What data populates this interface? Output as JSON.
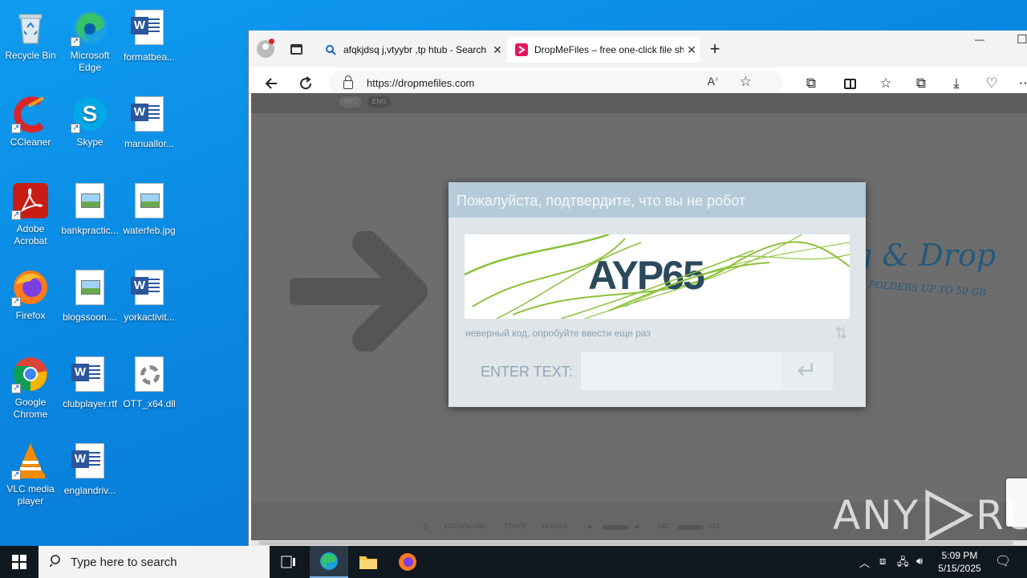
{
  "desktop": {
    "icons": [
      {
        "label": "Recycle Bin",
        "icon": "recycle-bin-icon"
      },
      {
        "label": "Microsoft Edge",
        "icon": "edge-icon"
      },
      {
        "label": "formatbea...",
        "icon": "word-doc-icon"
      },
      {
        "label": "CCleaner",
        "icon": "ccleaner-icon"
      },
      {
        "label": "Skype",
        "icon": "skype-icon"
      },
      {
        "label": "manuallor...",
        "icon": "word-doc-icon"
      },
      {
        "label": "Adobe Acrobat",
        "icon": "acrobat-icon"
      },
      {
        "label": "bankpractic...",
        "icon": "image-file-icon"
      },
      {
        "label": "waterfeb.jpg",
        "icon": "image-file-icon"
      },
      {
        "label": "Firefox",
        "icon": "firefox-icon"
      },
      {
        "label": "blogssoon....",
        "icon": "image-file-icon"
      },
      {
        "label": "yorkactivit...",
        "icon": "word-doc-icon"
      },
      {
        "label": "Google Chrome",
        "icon": "chrome-icon"
      },
      {
        "label": "clubplayer.rtf",
        "icon": "word-doc-icon"
      },
      {
        "label": "OTT_x64.dll",
        "icon": "dll-file-icon"
      },
      {
        "label": "VLC media player",
        "icon": "vlc-icon"
      },
      {
        "label": "englandriv...",
        "icon": "word-doc-icon"
      }
    ]
  },
  "browser": {
    "tabs": [
      {
        "title": "afqkjdsq j,vtyybr ,tp htub - Search",
        "active": false
      },
      {
        "title": "DropMeFiles – free one-click file sharing",
        "active": true
      }
    ],
    "new_tab_label": "+",
    "url": "https://dropmefiles.com",
    "window_controls": {
      "minimize": "—",
      "maximize": "☐"
    }
  },
  "page": {
    "lang_ru": "РУС",
    "lang_en": "ENG",
    "hero_text": "g & Drop",
    "hero_sub": "D FOLDERS UP TO 50 GB",
    "footer": {
      "download": "1 DOWNLOAD",
      "days7": "7 DAYS",
      "days14": "14 DAYS",
      "abc": "ABC",
      "num": "123"
    }
  },
  "captcha": {
    "title": "Пожалуйста, подтвердите, что вы не робот",
    "code": "AYP65",
    "error": "неверный код, опробуйте ввести еще раз",
    "enter_label": "ENTER TEXT:",
    "input_value": "",
    "submit_icon": "enter-arrow-icon"
  },
  "watermark": {
    "text_left": "ANY",
    "text_right": "RUN"
  },
  "taskbar": {
    "search_placeholder": "Type here to search",
    "time": "5:09 PM",
    "date": "5/15/2025"
  },
  "colors": {
    "desktop_bg": "#0a86e0",
    "captcha_header": "#b5cbd9",
    "captcha_text": "#2b4a5c",
    "taskbar": "#101820"
  }
}
